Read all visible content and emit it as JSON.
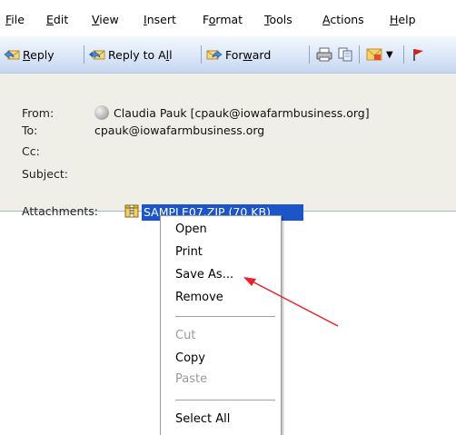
{
  "menu": {
    "items": [
      {
        "label": "File",
        "key": "F",
        "rest": "ile"
      },
      {
        "label": "Edit",
        "key": "E",
        "rest": "dit"
      },
      {
        "label": "View",
        "key": "V",
        "rest": "iew"
      },
      {
        "label": "Insert",
        "key": "I",
        "rest": "nsert"
      },
      {
        "label": "Format",
        "key": "o",
        "pre": "F",
        "rest": "rmat"
      },
      {
        "label": "Tools",
        "key": "T",
        "rest": "ools"
      },
      {
        "label": "Actions",
        "key": "A",
        "rest": "ctions"
      },
      {
        "label": "Help",
        "key": "H",
        "rest": "elp"
      }
    ]
  },
  "toolbar": {
    "reply": {
      "pre": "",
      "key": "R",
      "rest": "eply"
    },
    "reply_all": {
      "pre": "Reply to A",
      "key": "l",
      "rest": "l"
    },
    "forward": {
      "pre": "For",
      "key": "w",
      "rest": "ard"
    }
  },
  "header": {
    "from_label": "From:",
    "from_value": "Claudia Pauk [cpauk@iowafarmbusiness.org]",
    "to_label": "To:",
    "to_value": "cpauk@iowafarmbusiness.org",
    "cc_label": "Cc:",
    "subject_label": "Subject:",
    "attachments_label": "Attachments:",
    "attachment_name": "SAMPLE07.ZIP (70 KB)"
  },
  "context_menu": {
    "open": "Open",
    "print": "Print",
    "save_as": "Save As...",
    "remove": "Remove",
    "cut": "Cut",
    "copy": "Copy",
    "paste": "Paste",
    "select_all": "Select All"
  },
  "colors": {
    "toolbar_top": "#f4f8fe",
    "toolbar_bottom": "#c6d6f0",
    "header_bg": "#f0efe7",
    "selection": "#1c55c9",
    "arrow": "#e8212b"
  }
}
